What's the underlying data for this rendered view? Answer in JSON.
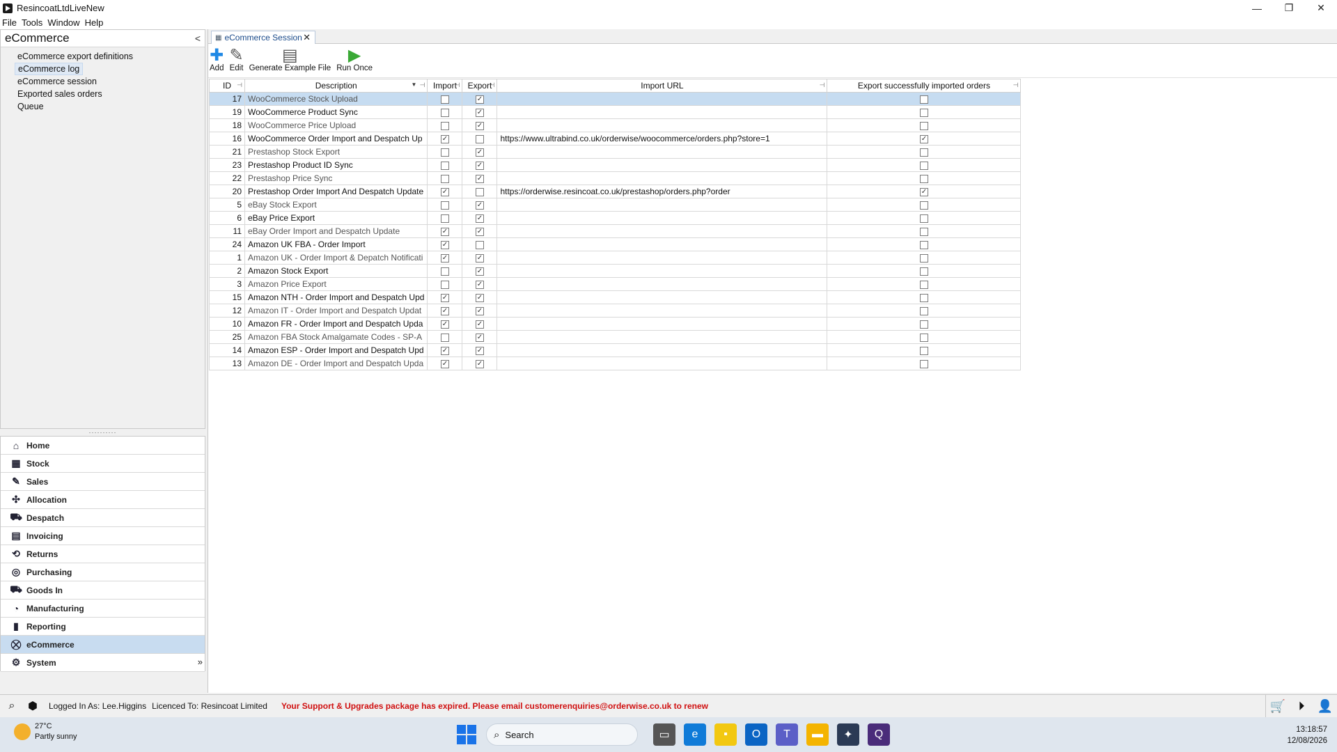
{
  "window": {
    "title": "ResincoatLtdLiveNew",
    "controls": {
      "minimize": "—",
      "restore": "❐",
      "close": "✕"
    }
  },
  "menu": [
    "File",
    "Tools",
    "Window",
    "Help"
  ],
  "left_panel": {
    "title": "eCommerce",
    "collapse": "<",
    "links": [
      "eCommerce export definitions",
      "eCommerce log",
      "eCommerce session",
      "Exported sales orders",
      "Queue"
    ],
    "splitter": "··········"
  },
  "modules": [
    {
      "label": "Home",
      "icon": "⌂"
    },
    {
      "label": "Stock",
      "icon": "▦"
    },
    {
      "label": "Sales",
      "icon": "✎"
    },
    {
      "label": "Allocation",
      "icon": "✣"
    },
    {
      "label": "Despatch",
      "icon": "⛟"
    },
    {
      "label": "Invoicing",
      "icon": "▤"
    },
    {
      "label": "Returns",
      "icon": "⟲"
    },
    {
      "label": "Purchasing",
      "icon": "◎"
    },
    {
      "label": "Goods In",
      "icon": "⛟"
    },
    {
      "label": "Manufacturing",
      "icon": "◔"
    },
    {
      "label": "Reporting",
      "icon": "▮"
    },
    {
      "label": "eCommerce",
      "icon": "⛒"
    },
    {
      "label": "System",
      "icon": "⚙"
    }
  ],
  "modules_overflow": "»",
  "tab": {
    "label": "eCommerce Session",
    "close": "✕"
  },
  "toolbar": [
    {
      "label": "Add",
      "icon": "✚",
      "color": "#1e88e5"
    },
    {
      "label": "Edit",
      "icon": "✎",
      "color": "#555555"
    },
    {
      "label": "Generate Example File",
      "icon": "▤",
      "color": "#555555"
    },
    {
      "label": "Run Once",
      "icon": "▶",
      "color": "#3aa936"
    }
  ],
  "grid": {
    "columns": [
      "ID",
      "Description",
      "Import",
      "Export",
      "Import URL",
      "Export successfully imported orders"
    ],
    "rows": [
      {
        "id": "17",
        "desc": "WooCommerce Stock Upload",
        "imp": false,
        "exp": true,
        "url": "",
        "esio": false,
        "active": false
      },
      {
        "id": "19",
        "desc": "WooCommerce Product Sync",
        "imp": false,
        "exp": true,
        "url": "",
        "esio": false,
        "active": true
      },
      {
        "id": "18",
        "desc": "WooCommerce Price Upload",
        "imp": false,
        "exp": true,
        "url": "",
        "esio": false,
        "active": false
      },
      {
        "id": "16",
        "desc": "WooCommerce Order Import and Despatch Up",
        "imp": true,
        "exp": false,
        "url": "https://www.ultrabind.co.uk/orderwise/woocommerce/orders.php?store=1",
        "esio": true,
        "active": true
      },
      {
        "id": "21",
        "desc": "Prestashop Stock Export",
        "imp": false,
        "exp": true,
        "url": "",
        "esio": false,
        "active": false
      },
      {
        "id": "23",
        "desc": "Prestashop Product ID Sync",
        "imp": false,
        "exp": true,
        "url": "",
        "esio": false,
        "active": true
      },
      {
        "id": "22",
        "desc": "Prestashop Price Sync",
        "imp": false,
        "exp": true,
        "url": "",
        "esio": false,
        "active": false
      },
      {
        "id": "20",
        "desc": "Prestashop Order Import And Despatch Update",
        "imp": true,
        "exp": false,
        "url": "https://orderwise.resincoat.co.uk/prestashop/orders.php?order",
        "esio": true,
        "active": true
      },
      {
        "id": "5",
        "desc": "eBay Stock Export",
        "imp": false,
        "exp": true,
        "url": "",
        "esio": false,
        "active": false
      },
      {
        "id": "6",
        "desc": "eBay Price Export",
        "imp": false,
        "exp": true,
        "url": "",
        "esio": false,
        "active": true
      },
      {
        "id": "11",
        "desc": "eBay Order Import and Despatch Update",
        "imp": true,
        "exp": true,
        "url": "",
        "esio": false,
        "active": false
      },
      {
        "id": "24",
        "desc": "Amazon UK FBA  - Order Import",
        "imp": true,
        "exp": false,
        "url": "",
        "esio": false,
        "active": true
      },
      {
        "id": "1",
        "desc": "Amazon UK - Order Import & Depatch Notificati",
        "imp": true,
        "exp": true,
        "url": "",
        "esio": false,
        "active": false
      },
      {
        "id": "2",
        "desc": "Amazon Stock Export",
        "imp": false,
        "exp": true,
        "url": "",
        "esio": false,
        "active": true
      },
      {
        "id": "3",
        "desc": "Amazon Price Export",
        "imp": false,
        "exp": true,
        "url": "",
        "esio": false,
        "active": false
      },
      {
        "id": "15",
        "desc": "Amazon NTH - Order Import and Despatch Upd",
        "imp": true,
        "exp": true,
        "url": "",
        "esio": false,
        "active": true
      },
      {
        "id": "12",
        "desc": "Amazon IT - Order Import and Despatch Updat",
        "imp": true,
        "exp": true,
        "url": "",
        "esio": false,
        "active": false
      },
      {
        "id": "10",
        "desc": "Amazon FR - Order Import and Despatch Upda",
        "imp": true,
        "exp": true,
        "url": "",
        "esio": false,
        "active": true
      },
      {
        "id": "25",
        "desc": "Amazon FBA Stock Amalgamate Codes - SP-A",
        "imp": false,
        "exp": true,
        "url": "",
        "esio": false,
        "active": false
      },
      {
        "id": "14",
        "desc": "Amazon ESP - Order Import and Despatch Upd",
        "imp": true,
        "exp": true,
        "url": "",
        "esio": false,
        "active": true
      },
      {
        "id": "13",
        "desc": "Amazon DE - Order Import and Despatch Upda",
        "imp": true,
        "exp": true,
        "url": "",
        "esio": false,
        "active": false
      }
    ],
    "selected_row": 0
  },
  "status": {
    "user": "Logged In As: Lee.Higgins",
    "licence": "Licenced To: Resincoat Limited",
    "warning": "Your Support & Upgrades package has expired. Please email customerenquiries@orderwise.co.uk to renew",
    "right_icons": [
      "cart-icon",
      "play-circle-icon",
      "user-icon"
    ]
  },
  "taskbar": {
    "temp": "27°C",
    "weather": "Partly sunny",
    "search": "Search",
    "apps": [
      {
        "name": "task-view",
        "color": "#555555",
        "glyph": "▭"
      },
      {
        "name": "edge",
        "color": "#0f7bd8",
        "glyph": "e"
      },
      {
        "name": "sticky-notes",
        "color": "#f2c811",
        "glyph": "▪"
      },
      {
        "name": "outlook",
        "color": "#0a64c4",
        "glyph": "O"
      },
      {
        "name": "teams",
        "color": "#5b5fc7",
        "glyph": "T"
      },
      {
        "name": "file-explorer",
        "color": "#f4b400",
        "glyph": "▬"
      },
      {
        "name": "orderwise",
        "color": "#2b3a55",
        "glyph": "✦"
      },
      {
        "name": "app-q",
        "color": "#4a2c7a",
        "glyph": "Q"
      }
    ],
    "time": "13:18:57",
    "date": "12/08/2026"
  }
}
